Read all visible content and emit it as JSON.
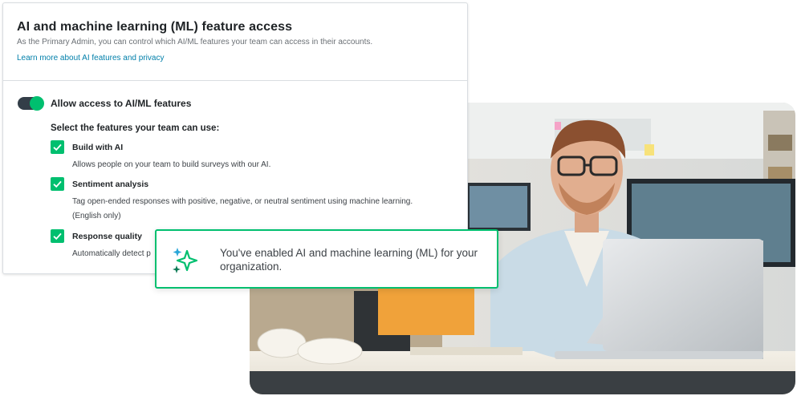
{
  "settings_card": {
    "title": "AI and machine learning (ML) feature access",
    "description": "As the Primary Admin, you can control which AI/ML features your team can access in their accounts.",
    "learn_more_link": "Learn more about AI features and privacy",
    "toggle": {
      "label": "Allow access to AI/ML features",
      "state": "on",
      "track_color": "#333e48",
      "knob_color": "#00bf6f"
    },
    "features_heading": "Select the features your team can use:",
    "features": [
      {
        "name": "Build with AI",
        "checked": true,
        "description": "Allows people on your team to build surveys with our AI."
      },
      {
        "name": "Sentiment analysis",
        "checked": true,
        "description": "Tag open-ended responses with positive, negative, or neutral sentiment using machine learning. (English only)"
      },
      {
        "name": "Response quality",
        "checked": true,
        "description": "Automatically detect p"
      }
    ]
  },
  "toast": {
    "icon": "sparkle-icon",
    "message": "You've enabled AI and machine learning (ML) for your organization.",
    "border_color": "#00bf6f"
  },
  "photo": {
    "subject": "man-with-glasses-using-laptop-photo"
  },
  "colors": {
    "accent_green": "#00bf6f",
    "link_blue": "#007faa",
    "text_dark": "#1f2326"
  }
}
